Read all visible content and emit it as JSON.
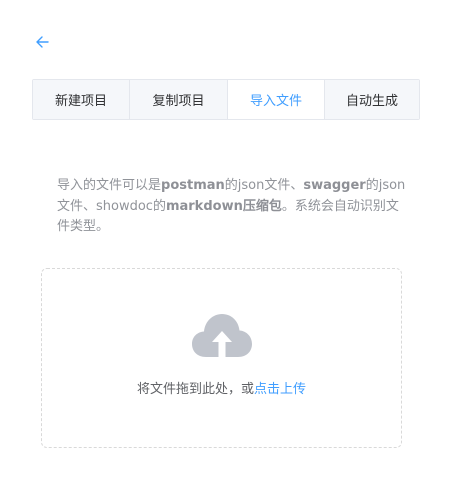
{
  "nav": {
    "back_icon": "arrow-left-icon"
  },
  "tabs": [
    {
      "label": "新建项目",
      "active": false
    },
    {
      "label": "复制项目",
      "active": false
    },
    {
      "label": "导入文件",
      "active": true
    },
    {
      "label": "自动生成",
      "active": false
    }
  ],
  "description": {
    "p1": "导入的文件可以是",
    "b1": "postman",
    "p2": "的json文件、",
    "b2": "swagger",
    "p3": "的json文件、showdoc的",
    "b3": "markdown压缩包",
    "p4": "。系统会自动识别文件类型。"
  },
  "upload": {
    "icon": "cloud-upload-icon",
    "text": "将文件拖到此处，或",
    "link": "点击上传"
  },
  "colors": {
    "accent": "#409eff",
    "muted_text": "#909399",
    "icon_gray": "#c0c4cc",
    "border": "#e4e7ed"
  }
}
